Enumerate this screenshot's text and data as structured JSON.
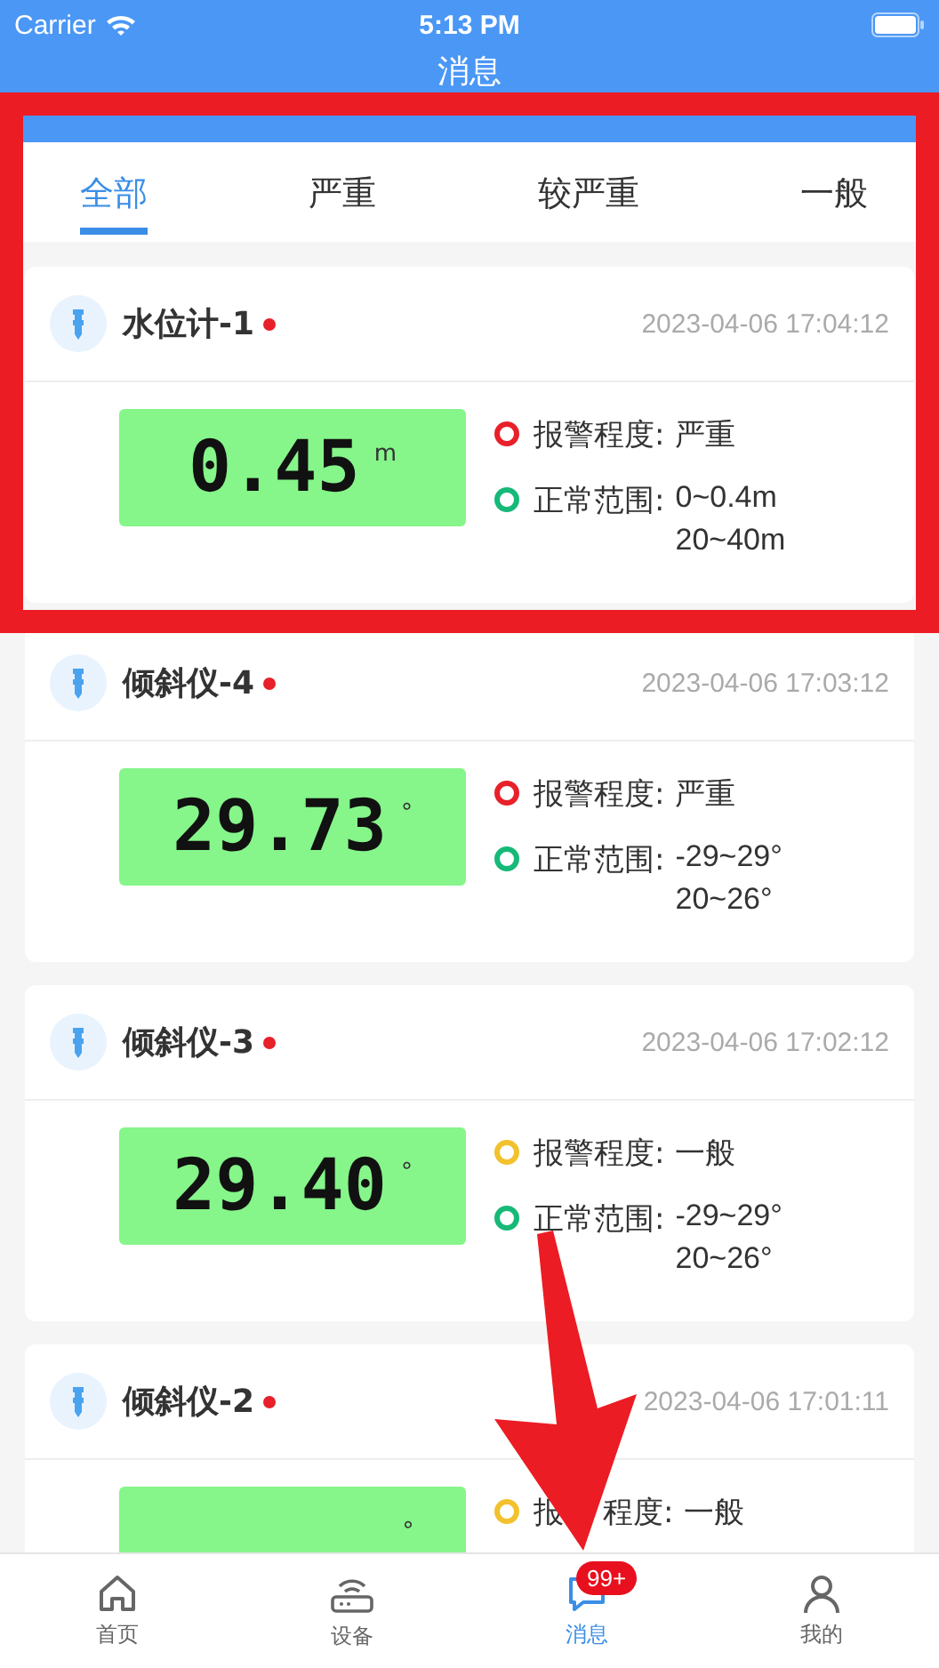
{
  "status_bar": {
    "carrier": "Carrier",
    "time": "5:13 PM"
  },
  "nav": {
    "title": "消息"
  },
  "tabs": [
    {
      "label": "全部",
      "selected": true
    },
    {
      "label": "严重",
      "selected": false
    },
    {
      "label": "较严重",
      "selected": false
    },
    {
      "label": "一般",
      "selected": false
    }
  ],
  "alarms": [
    {
      "device": "水位计-1",
      "unread": true,
      "time": "2023-04-06 17:04:12",
      "reading": "0.45",
      "unit": "m",
      "alarm_label": "报警程度:",
      "alarm_level": "严重",
      "color": "#e8202a",
      "range_label": "正常范围:",
      "range": [
        "0~0.4m",
        "20~40m"
      ]
    },
    {
      "device": "倾斜仪-4",
      "unread": true,
      "time": "2023-04-06 17:03:12",
      "reading": "29.73",
      "unit": "°",
      "alarm_label": "报警程度:",
      "alarm_level": "严重",
      "color": "#e8202a",
      "range_label": "正常范围:",
      "range": [
        "-29~29°",
        "20~26°"
      ]
    },
    {
      "device": "倾斜仪-3",
      "unread": true,
      "time": "2023-04-06 17:02:12",
      "reading": "29.40",
      "unit": "°",
      "alarm_label": "报警程度:",
      "alarm_level": "一般",
      "color": "#f2c12e",
      "range_label": "正常范围:",
      "range": [
        "-29~29°",
        "20~26°"
      ]
    },
    {
      "device": "倾斜仪-2",
      "unread": true,
      "time": "2023-04-06 17:01:11",
      "unit": "°",
      "alarm_label": "报",
      "alarm_label_tail": "程度:",
      "alarm_level": "一般",
      "color": "#f2c12e"
    }
  ],
  "tab_bar": [
    {
      "kind": "home",
      "label": "首页",
      "selected": false
    },
    {
      "kind": "device",
      "label": "设备",
      "selected": false
    },
    {
      "kind": "message",
      "label": "消息",
      "selected": true,
      "badge": "99+"
    },
    {
      "kind": "profile",
      "label": "我的",
      "selected": false
    }
  ]
}
